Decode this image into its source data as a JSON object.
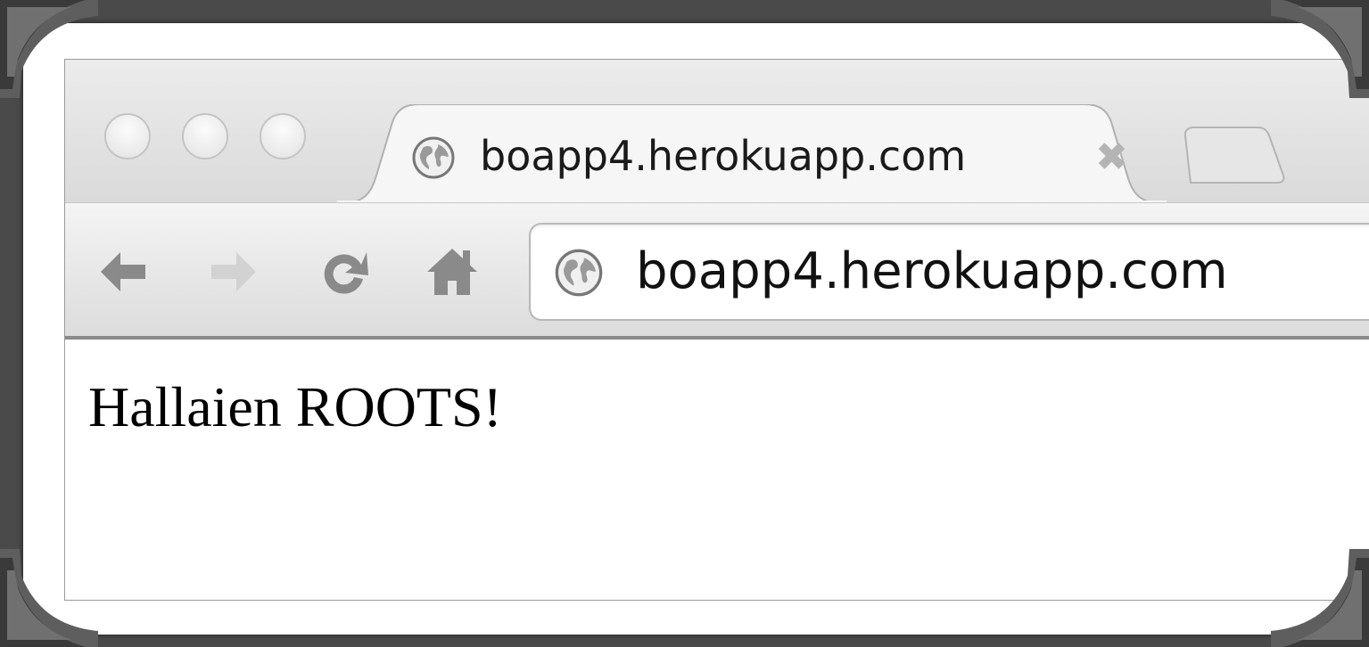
{
  "tab": {
    "title": "boapp4.herokuapp.com",
    "close_glyph": "✖",
    "favicon": "globe-icon"
  },
  "toolbar": {
    "back_icon": "back-arrow-icon",
    "forward_icon": "forward-arrow-icon",
    "reload_icon": "reload-icon",
    "home_icon": "home-icon"
  },
  "omnibox": {
    "url": "boapp4.herokuapp.com",
    "icon": "globe-icon"
  },
  "page": {
    "text": "Hallaien ROOTS!"
  },
  "colors": {
    "background": "#4a4a4a",
    "mat": "#ffffff",
    "chrome_light": "#ececec",
    "chrome_dark": "#dadada",
    "icon_gray": "#8a8a8a"
  }
}
